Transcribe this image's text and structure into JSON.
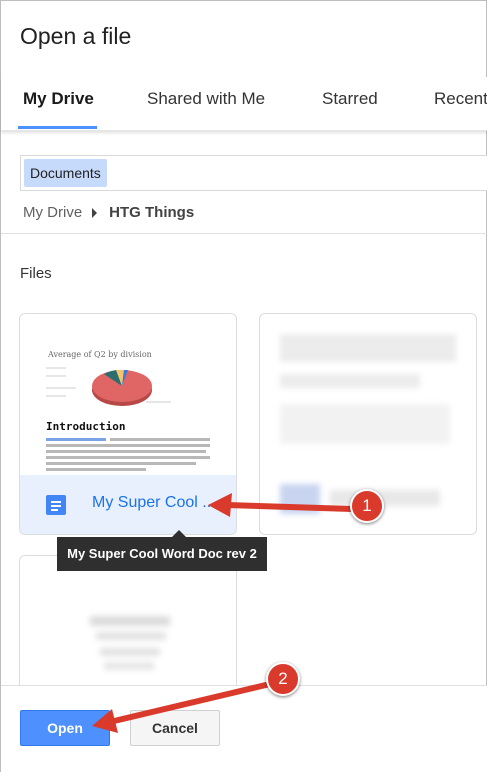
{
  "dialog": {
    "title": "Open a file"
  },
  "tabs": [
    {
      "label": "My Drive",
      "active": true
    },
    {
      "label": "Shared with Me",
      "active": false
    },
    {
      "label": "Starred",
      "active": false
    },
    {
      "label": "Recent",
      "active": false
    }
  ],
  "search": {
    "chip": "Documents"
  },
  "breadcrumb": {
    "root": "My Drive",
    "current": "HTG Things"
  },
  "files": {
    "section_label": "Files",
    "items": [
      {
        "name": "My Super Cool ...",
        "tooltip": "My Super Cool Word Doc rev 2",
        "icon": "google-docs-icon",
        "selected": true,
        "thumbnail": {
          "chart_title": "Average of Q2 by division",
          "heading": "Introduction"
        }
      },
      {
        "name": "",
        "icon": "",
        "selected": false,
        "blurred": true
      },
      {
        "name": "",
        "icon": "",
        "selected": false,
        "blurred": true
      }
    ]
  },
  "buttons": {
    "open": "Open",
    "cancel": "Cancel"
  },
  "annotations": [
    {
      "number": "1"
    },
    {
      "number": "2"
    }
  ],
  "colors": {
    "accent": "#4d90fe",
    "selected_bg": "#e8f0fe",
    "annotation_red": "#d93a2b",
    "chip_bg": "#c6dafc"
  }
}
